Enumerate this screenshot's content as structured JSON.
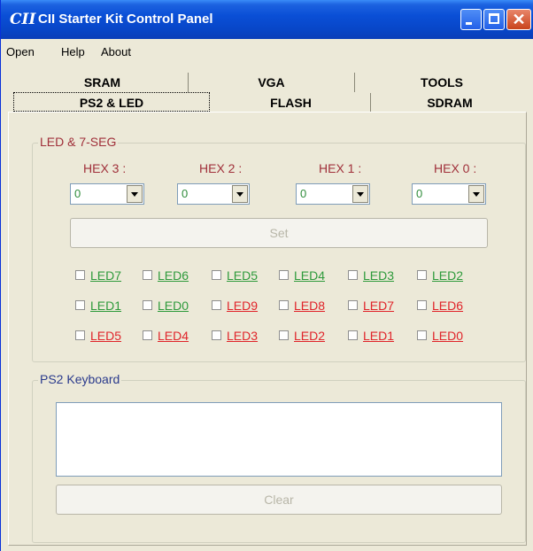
{
  "window": {
    "logo": "CII",
    "title": "CII Starter Kit Control Panel"
  },
  "menu": [
    "Open",
    "Help",
    "About"
  ],
  "tabs": {
    "row1": [
      "SRAM",
      "VGA",
      "TOOLS"
    ],
    "row2": [
      "PS2 & LED",
      "FLASH",
      "SDRAM"
    ]
  },
  "led_group": {
    "title": "LED & 7-SEG",
    "hex": [
      {
        "label": "HEX 3 :",
        "value": "0"
      },
      {
        "label": "HEX 2 :",
        "value": "0"
      },
      {
        "label": "HEX 1 :",
        "value": "0"
      },
      {
        "label": "HEX 0 :",
        "value": "0"
      }
    ],
    "set_label": "Set",
    "green_color": "#2e9a3b",
    "red_color": "#e0242a",
    "rows": [
      [
        {
          "label": "LED7",
          "color": "green"
        },
        {
          "label": "LED6",
          "color": "green"
        },
        {
          "label": "LED5",
          "color": "green"
        },
        {
          "label": "LED4",
          "color": "green"
        },
        {
          "label": "LED3",
          "color": "green"
        },
        {
          "label": "LED2",
          "color": "green"
        }
      ],
      [
        {
          "label": "LED1",
          "color": "green"
        },
        {
          "label": "LED0",
          "color": "green"
        },
        {
          "label": "LED9",
          "color": "red"
        },
        {
          "label": "LED8",
          "color": "red"
        },
        {
          "label": "LED7",
          "color": "red"
        },
        {
          "label": "LED6",
          "color": "red"
        }
      ],
      [
        {
          "label": "LED5",
          "color": "red"
        },
        {
          "label": "LED4",
          "color": "red"
        },
        {
          "label": "LED3",
          "color": "red"
        },
        {
          "label": "LED2",
          "color": "red"
        },
        {
          "label": "LED1",
          "color": "red"
        },
        {
          "label": "LED0",
          "color": "red"
        }
      ]
    ]
  },
  "ps2_group": {
    "title": "PS2 Keyboard",
    "text": "",
    "clear_label": "Clear"
  }
}
